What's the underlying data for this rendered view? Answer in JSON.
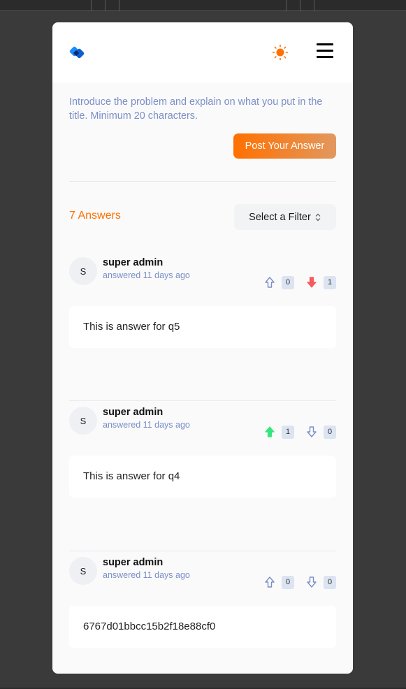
{
  "header": {
    "logo_icon": "devflow-logo-icon",
    "theme_icon": "sun-icon",
    "menu_icon": "hamburger-menu-icon"
  },
  "description": "Introduce the problem and explain on what you put in the title. Minimum 20 characters.",
  "post_button": "Post Your Answer",
  "answers_count": "7 Answers",
  "filter": {
    "label": "Select a Filter"
  },
  "colors": {
    "accent": "#ff7000",
    "muted_text": "#7b8ec8",
    "upvoted": "#37e57f",
    "downvoted": "#f25c5c"
  },
  "answers": [
    {
      "initial": "S",
      "author": "super admin",
      "time": "answered 11 days ago",
      "upvotes": "0",
      "downvotes": "1",
      "upvote_state": "none",
      "downvote_state": "active",
      "body": "This is answer for q5"
    },
    {
      "initial": "S",
      "author": "super admin",
      "time": "answered 11 days ago",
      "upvotes": "1",
      "downvotes": "0",
      "upvote_state": "active",
      "downvote_state": "none",
      "body": "This is answer for q4"
    },
    {
      "initial": "S",
      "author": "super admin",
      "time": "answered 11 days ago",
      "upvotes": "0",
      "downvotes": "0",
      "upvote_state": "none",
      "downvote_state": "none",
      "body": "6767d01bbcc15b2f18e88cf0"
    }
  ]
}
